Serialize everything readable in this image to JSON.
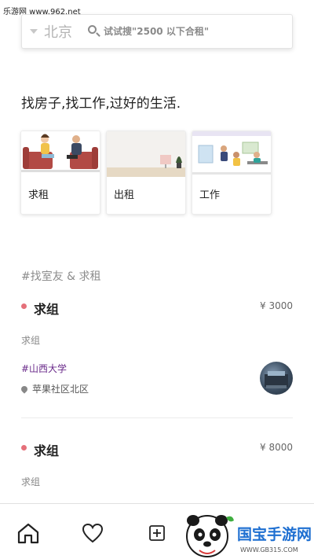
{
  "watermark_top": "乐游网 www.962.net",
  "search": {
    "city": "北京",
    "placeholder": "试试搜\"2500 以下合租\""
  },
  "slogan": "找房子,找工作,过好的生活.",
  "categories": [
    {
      "label": "求租"
    },
    {
      "label": "出租"
    },
    {
      "label": "工作"
    }
  ],
  "section_title": "#找室友 & 求租",
  "posts": [
    {
      "title": "求组",
      "price": "¥ 3000",
      "subtitle": "求组",
      "tag": "#山西大学",
      "location": "苹果社区北区"
    },
    {
      "title": "求组",
      "price": "¥ 8000",
      "subtitle": "求组"
    }
  ],
  "bottom_nav": {
    "items": [
      "home-icon",
      "heart-icon",
      "plus-square-icon"
    ]
  },
  "logo_watermark": {
    "text": "国宝手游网",
    "url": "WWW.GB315.COM"
  },
  "colors": {
    "accent_dot": "#e5707a",
    "tag": "#6a2a8a",
    "muted": "#8c8c8c"
  }
}
